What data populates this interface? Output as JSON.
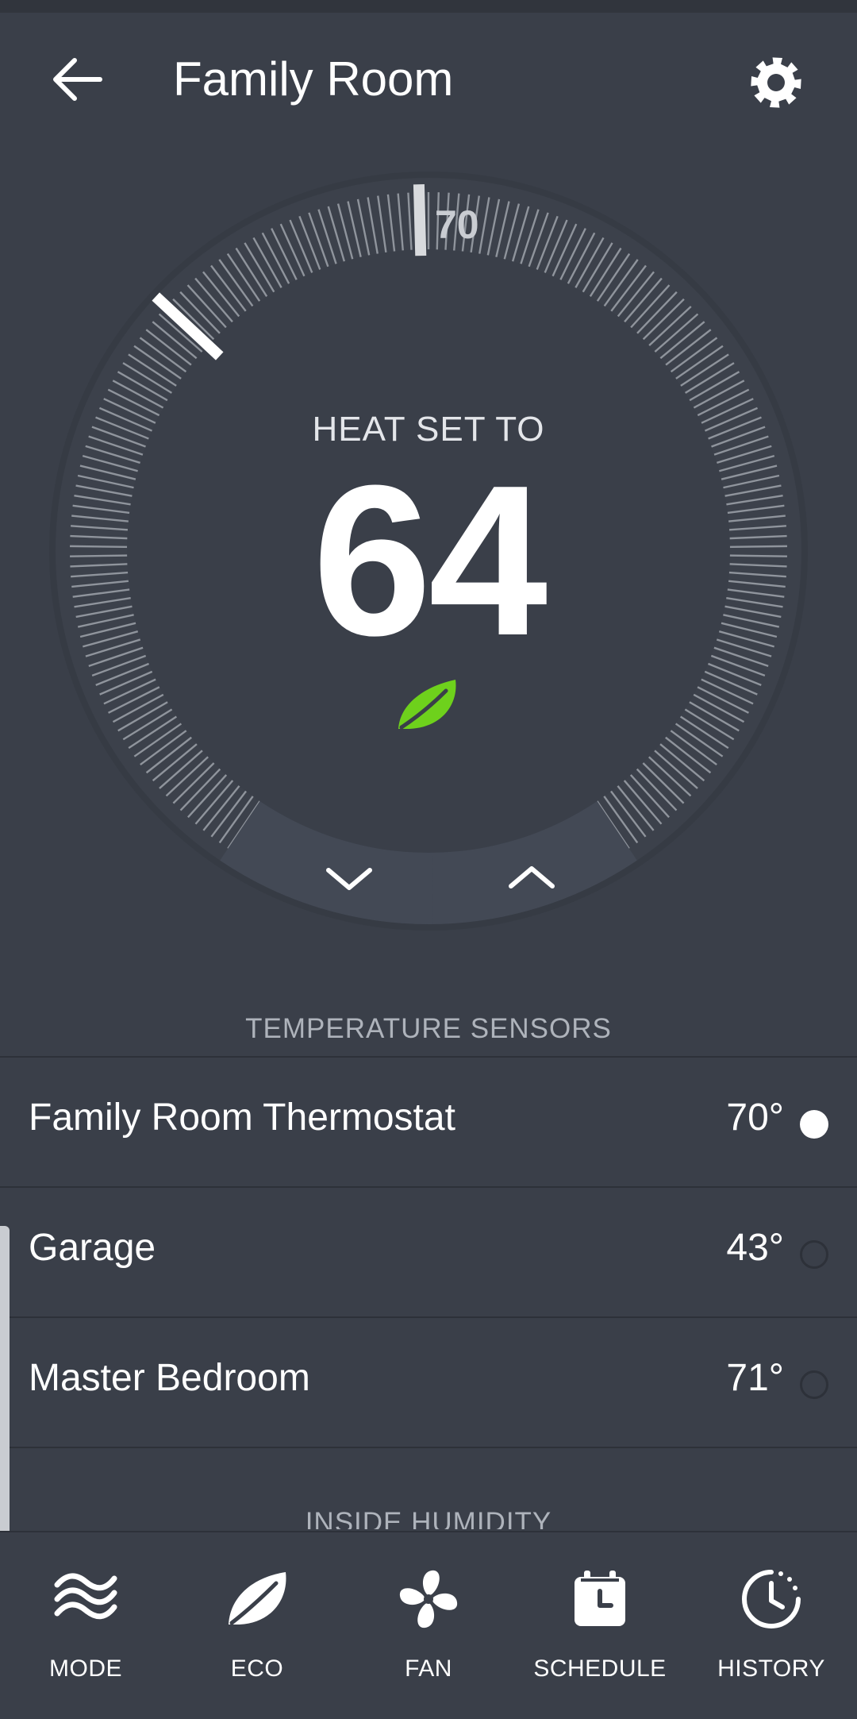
{
  "header": {
    "title": "Family Room",
    "back_icon": "arrow-left-icon",
    "settings_icon": "gear-icon"
  },
  "thermostat": {
    "mode_label": "HEAT SET TO",
    "setpoint": "64",
    "current_temp": "70",
    "eco_icon": "leaf-icon",
    "down_icon": "chevron-down-icon",
    "up_icon": "chevron-up-icon",
    "colors": {
      "eco_green": "#6ed11c",
      "background": "#3a3f49",
      "tick": "#8f949c"
    }
  },
  "sensors": {
    "title": "TEMPERATURE SENSORS",
    "items": [
      {
        "name": "Family Room Thermostat",
        "temp": "70°",
        "active": true
      },
      {
        "name": "Garage",
        "temp": "43°",
        "active": false
      },
      {
        "name": "Master Bedroom",
        "temp": "71°",
        "active": false
      }
    ]
  },
  "humidity": {
    "title": "INSIDE HUMIDITY"
  },
  "nav": {
    "items": [
      {
        "label": "MODE",
        "icon": "waves-icon"
      },
      {
        "label": "ECO",
        "icon": "leaf-icon"
      },
      {
        "label": "FAN",
        "icon": "fan-icon"
      },
      {
        "label": "SCHEDULE",
        "icon": "calendar-clock-icon"
      },
      {
        "label": "HISTORY",
        "icon": "history-clock-icon"
      }
    ]
  }
}
